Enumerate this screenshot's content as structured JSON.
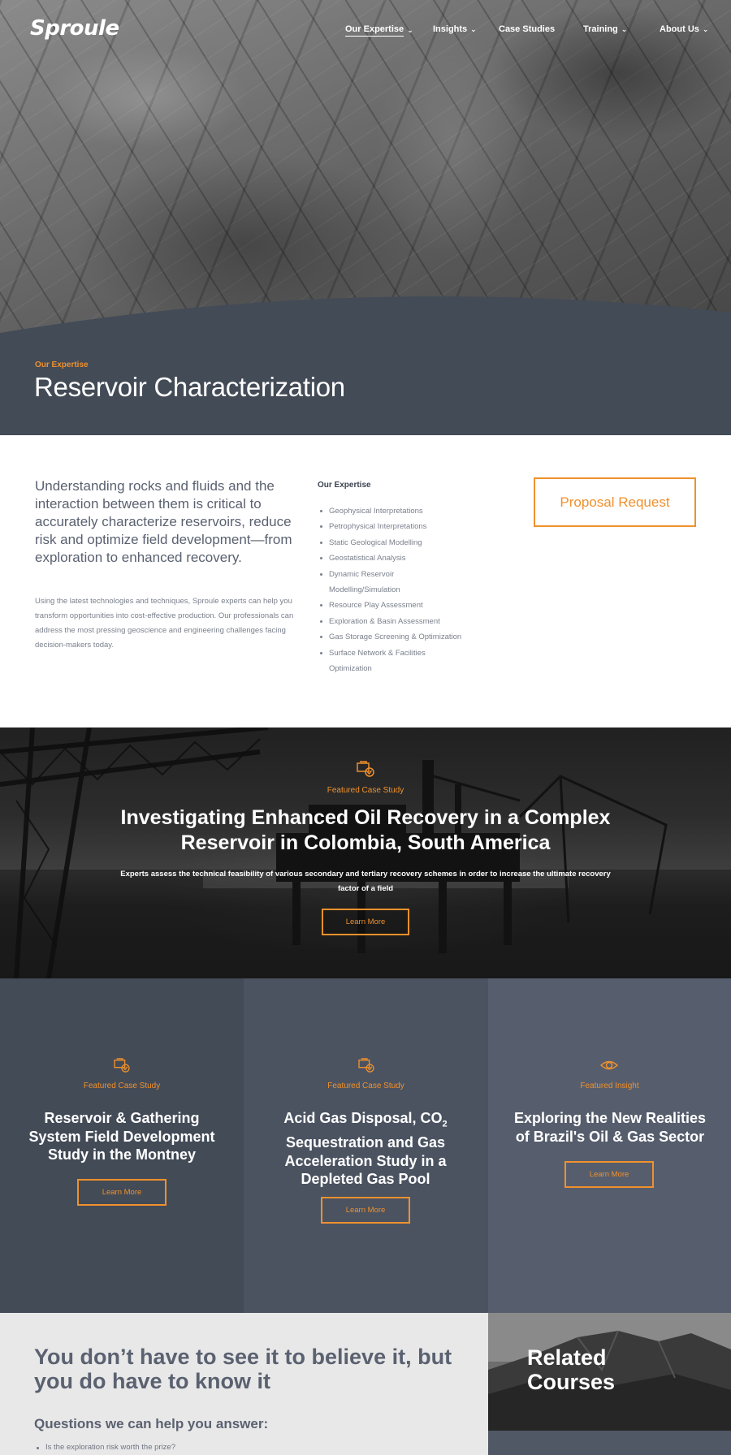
{
  "brand": {
    "logo_text": "Sproule",
    "accent": "#f0912c"
  },
  "nav": {
    "items": [
      {
        "label": "Our Expertise",
        "has_dropdown": true,
        "active": true
      },
      {
        "label": "Insights",
        "has_dropdown": true
      },
      {
        "label": "Case Studies",
        "has_dropdown": false
      },
      {
        "label": "Training",
        "has_dropdown": true
      },
      {
        "label": "About Us",
        "has_dropdown": true
      }
    ]
  },
  "hero": {
    "eyebrow": "Our Expertise",
    "title": "Reservoir Characterization"
  },
  "intro": {
    "lead": "Understanding rocks and fluids and the interaction between them is critical to accurately characterize reservoirs, reduce risk and optimize field development—from exploration to enhanced recovery.",
    "body": "Using the latest technologies and techniques, Sproule experts can help you transform opportunities into cost-effective production. Our professionals can address the most pressing geoscience and engineering challenges facing decision-makers today.",
    "expertise_title": "Our Expertise",
    "expertise_items": [
      "Geophysical Interpretations",
      "Petrophysical Interpretations",
      "Static Geological Modelling",
      "Geostatistical Analysis",
      "Dynamic Reservoir Modelling/Simulation",
      "Resource Play Assessment",
      "Exploration & Basin Assessment",
      "Gas Storage Screening & Optimization",
      "Surface Network & Facilities Optimization"
    ],
    "proposal_button": "Proposal Request"
  },
  "featured": {
    "icon": "case-study-icon",
    "eyebrow": "Featured Case Study",
    "title": "Investigating Enhanced Oil Recovery in a Complex Reservoir in Colombia, South America",
    "description": "Experts assess the technical feasibility of various secondary and tertiary recovery schemes in order to increase the ultimate recovery factor of a field",
    "button": "Learn More"
  },
  "cards": [
    {
      "icon": "case-study-icon",
      "eyebrow": "Featured Case Study",
      "title": "Reservoir & Gathering System Field Development Study in the Montney",
      "button": "Learn More"
    },
    {
      "icon": "case-study-icon",
      "eyebrow": "Featured Case Study",
      "title_before": "Acid Gas Disposal, CO",
      "title_sub": "2",
      "title_after": " Sequestration and Gas Acceleration Study in a Depleted Gas Pool",
      "button": "Learn More"
    },
    {
      "icon": "eye-icon",
      "eyebrow": "Featured Insight",
      "title": "Exploring the New Realities of Brazil's Oil & Gas Sector",
      "button": "Learn More"
    }
  ],
  "bottom": {
    "title": "You don’t have to see it to believe it, but you do have to know it",
    "subtitle": "Questions we can help you answer:",
    "questions": [
      "Is the exploration risk worth the prize?"
    ],
    "related_title": "Related Courses"
  }
}
